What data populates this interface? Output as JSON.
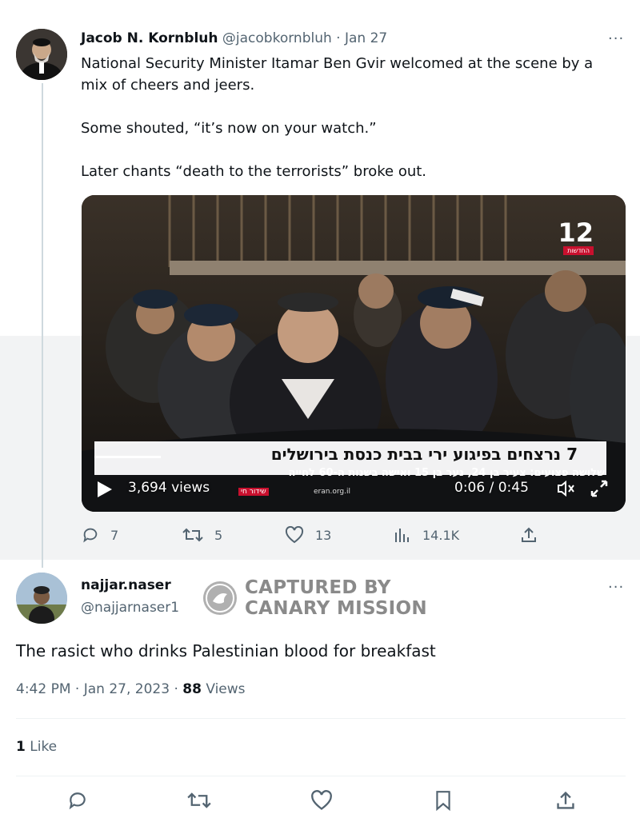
{
  "tweet1": {
    "display_name": "Jacob N. Kornbluh",
    "handle": "@jacobkornbluh",
    "separator": "·",
    "date": "Jan 27",
    "more": "···",
    "text_p1": "National Security Minister Itamar Ben Gvir welcomed at the scene by a",
    "text_p1b": "mix of cheers and jeers.",
    "text_p2": "Some shouted, “it’s now on your watch.”",
    "text_p3": "Later chants “death to the terrorists” broke out.",
    "video": {
      "channel_logo": "12",
      "channel_sub": "החדשות",
      "headline": "7 נרצחים בפיגוע ירי בבית כנסת בירושלים",
      "subline": "שלושה פצועים: צעיר בן 24, נער בן 15 ואישה בשנות ה-60 לחייה",
      "views": "3,694 views",
      "time": "0:06 / 0:45",
      "live_label": "שידור חי",
      "site": "eran.org.il",
      "progress": 0.13,
      "mute_icon": "speaker-muted-icon",
      "fullscreen_icon": "expand-icon"
    },
    "actions": {
      "replies": "7",
      "retweets": "5",
      "likes": "13",
      "views": "14.1K"
    }
  },
  "tweet2": {
    "display_name": "najjar.naser",
    "handle": "@najjarnaser1",
    "more": "···",
    "watermark_line1": "CAPTURED BY",
    "watermark_line2": "CANARY MISSION",
    "text": "The rasict who drinks Palestinian blood for breakfast",
    "time": "4:42 PM",
    "date": "Jan 27, 2023",
    "views_count": "88",
    "views_label": "Views",
    "likes_count": "1",
    "likes_label": "Like"
  },
  "colors": {
    "muted": "#536471",
    "text": "#0f1419",
    "band": "#f2f3f4"
  }
}
